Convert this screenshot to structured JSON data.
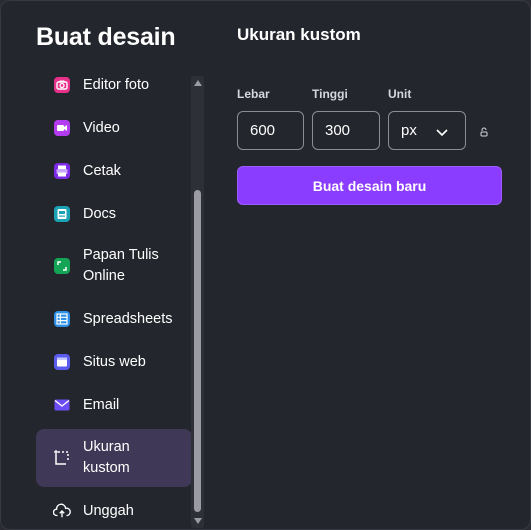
{
  "sidebar": {
    "title": "Buat desain",
    "items": [
      {
        "label": "Editor foto",
        "icon": "camera-icon",
        "color": "#e8318a"
      },
      {
        "label": "Video",
        "icon": "video-camera-icon",
        "color": "#b43cf0"
      },
      {
        "label": "Cetak",
        "icon": "printer-icon",
        "color": "#7d2ae8"
      },
      {
        "label": "Docs",
        "icon": "doc-icon",
        "color": "#1aa3b5"
      },
      {
        "label": "Papan Tulis Online",
        "icon": "whiteboard-icon",
        "color": "#13a455"
      },
      {
        "label": "Spreadsheets",
        "icon": "spreadsheet-icon",
        "color": "#2e8fe8"
      },
      {
        "label": "Situs web",
        "icon": "website-icon",
        "color": "#5b5bf0"
      },
      {
        "label": "Email",
        "icon": "email-icon",
        "color": "#6c4cf5"
      },
      {
        "label": "Ukuran kustom",
        "icon": "custom-size-icon",
        "color": "#ffffff",
        "active": true
      },
      {
        "label": "Unggah",
        "icon": "upload-cloud-icon",
        "color": "#ffffff"
      }
    ]
  },
  "main": {
    "title": "Ukuran kustom",
    "width_label": "Lebar",
    "width_value": "600",
    "height_label": "Tinggi",
    "height_value": "300",
    "unit_label": "Unit",
    "unit_value": "px",
    "create_button": "Buat desain baru"
  },
  "colors": {
    "background": "#24262d",
    "accent": "#8b3dff",
    "active_item": "#3f3856"
  }
}
